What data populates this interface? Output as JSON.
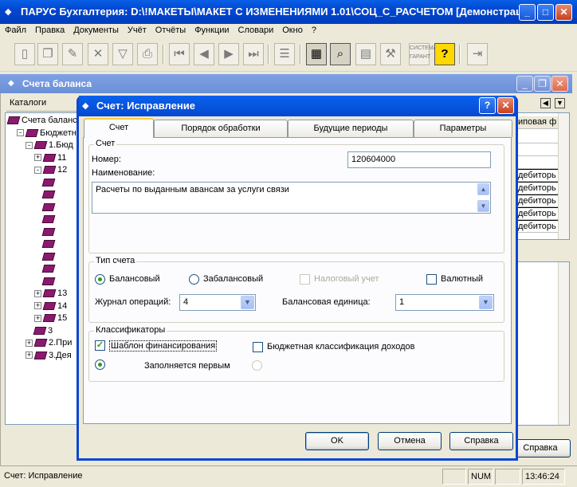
{
  "app": {
    "title": "ПАРУС Бухгалтерия: D:\\!МАКЕТЫ\\МАКЕТ С ИЗМЕНЕНИЯМИ 1.01\\СОЦ_С_РАСЧЕТОМ [Демонстрац...",
    "controls": {
      "minimize": "_",
      "maximize": "□",
      "close": "✕"
    }
  },
  "menu": [
    "Файл",
    "Правка",
    "Документы",
    "Учёт",
    "Отчёты",
    "Функции",
    "Словари",
    "Окно",
    "?"
  ],
  "toolbar_icons": [
    "new-doc-icon",
    "copy-doc-icon",
    "edit-doc-icon",
    "delete-icon",
    "filter-icon",
    "print-icon",
    "first-icon",
    "prev-icon",
    "next-icon",
    "last-icon",
    "list-icon",
    "calculator-icon",
    "search-doc-icon",
    "calendar-icon",
    "tools-icon",
    "garant-icon",
    "help-icon",
    "exit-icon"
  ],
  "child_window": {
    "title": "Счета баланса",
    "catalogs_label": "Каталоги",
    "tree": [
      {
        "text": "Счета балансо",
        "indent": 0,
        "exp": ""
      },
      {
        "text": "Бюджетн",
        "indent": 1,
        "exp": "-"
      },
      {
        "text": "1.Бюд",
        "indent": 2,
        "exp": "-"
      },
      {
        "text": "11",
        "indent": 3,
        "exp": "+"
      },
      {
        "text": "12",
        "indent": 3,
        "exp": "-"
      },
      {
        "text": "",
        "indent": 4,
        "exp": ""
      },
      {
        "text": "",
        "indent": 4,
        "exp": ""
      },
      {
        "text": "",
        "indent": 4,
        "exp": ""
      },
      {
        "text": "",
        "indent": 4,
        "exp": ""
      },
      {
        "text": "",
        "indent": 4,
        "exp": ""
      },
      {
        "text": "",
        "indent": 4,
        "exp": ""
      },
      {
        "text": "",
        "indent": 4,
        "exp": ""
      },
      {
        "text": "",
        "indent": 4,
        "exp": ""
      },
      {
        "text": "",
        "indent": 4,
        "exp": ""
      },
      {
        "text": "13",
        "indent": 3,
        "exp": "+"
      },
      {
        "text": "14",
        "indent": 3,
        "exp": "+"
      },
      {
        "text": "15",
        "indent": 3,
        "exp": "+"
      },
      {
        "text": "3",
        "indent": 3,
        "exp": ""
      },
      {
        "text": "2.При",
        "indent": 2,
        "exp": "+"
      },
      {
        "text": "3.Дея",
        "indent": 2,
        "exp": "+"
      }
    ],
    "right_header": "иповая ф",
    "right_cells": [
      "",
      "",
      "",
      "дебиторь",
      "дебиторь",
      "дебиторь",
      "дебиторь",
      "дебиторь"
    ],
    "help_button": "Справка"
  },
  "dialog": {
    "title": "Счет: Исправление",
    "tabs": [
      "Счет",
      "Порядок обработки",
      "Будущие периоды",
      "Параметры"
    ],
    "group_account": {
      "label": "Счет",
      "number_label": "Номер:",
      "number_value": "120604000",
      "name_label": "Наименование:",
      "name_value": "Расчеты по выданным авансам за  услуги связи"
    },
    "group_type": {
      "label": "Тип счета",
      "balance": "Балансовый",
      "offbalance": "Забалансовый",
      "tax": "Налоговый учет",
      "currency": "Валютный",
      "journal_label": "Журнал операций:",
      "journal_value": "4",
      "unit_label": "Балансовая единица:",
      "unit_value": "1"
    },
    "group_class": {
      "label": "Классификаторы",
      "template": "Шаблон финансирования",
      "budget": "Бюджетная классификация доходов",
      "first": "Заполняется первым"
    },
    "buttons": {
      "ok": "OK",
      "cancel": "Отмена",
      "help": "Справка"
    }
  },
  "status": {
    "text": "Счет: Исправление",
    "num": "NUM",
    "time": "13:46:24"
  }
}
